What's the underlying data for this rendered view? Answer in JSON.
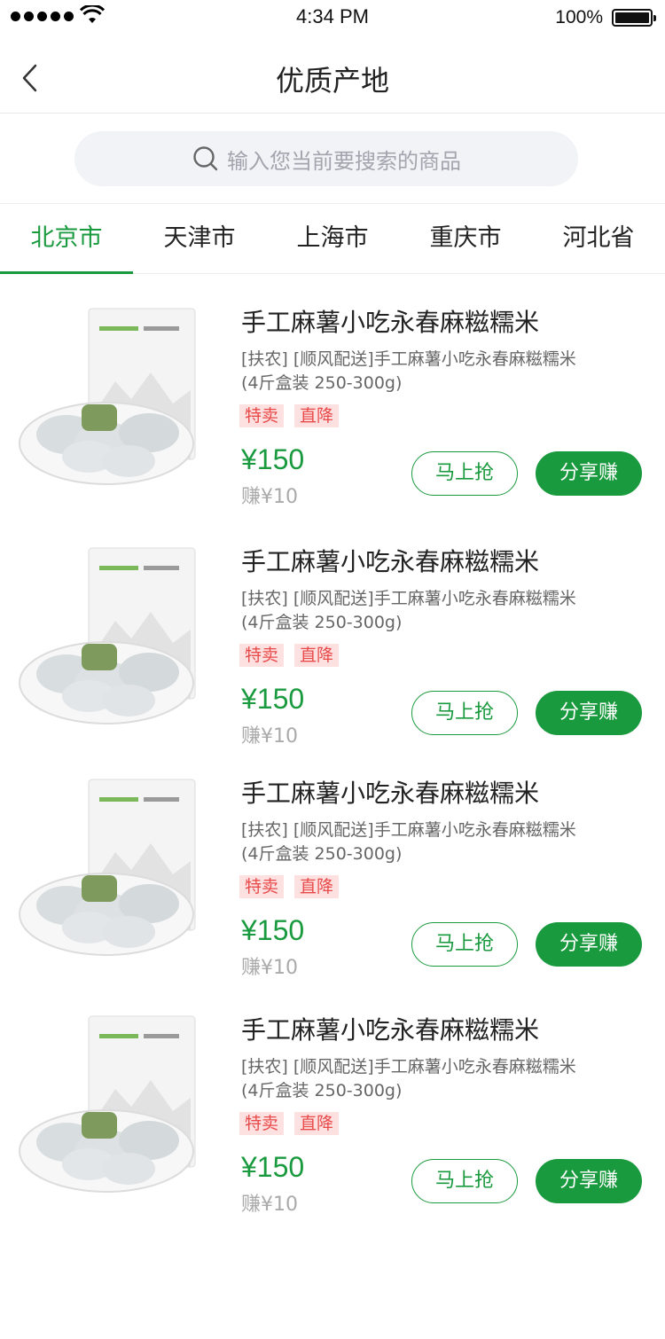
{
  "status_bar": {
    "time": "4:34 PM",
    "battery": "100%"
  },
  "nav": {
    "title": "优质产地"
  },
  "search": {
    "placeholder": "输入您当前要搜索的商品"
  },
  "tabs": [
    {
      "label": "北京市",
      "active": true
    },
    {
      "label": "天津市",
      "active": false
    },
    {
      "label": "上海市",
      "active": false
    },
    {
      "label": "重庆市",
      "active": false
    },
    {
      "label": "河北省",
      "active": false
    }
  ],
  "colors": {
    "accent": "#1a9a3e",
    "tag_text": "#e84a4a",
    "tag_bg": "#fde0e0"
  },
  "products": [
    {
      "title": "手工麻薯小吃永春麻糍糯米",
      "desc_line1": "[扶农] [顺风配送]手工麻薯小吃永春麻糍糯米",
      "desc_line2": "(4斤盒装 250-300g)",
      "tag1": "特卖",
      "tag2": "直降",
      "price": "¥150",
      "earn": "赚¥10",
      "grab_label": "马上抢",
      "share_label": "分享赚"
    },
    {
      "title": "手工麻薯小吃永春麻糍糯米",
      "desc_line1": "[扶农] [顺风配送]手工麻薯小吃永春麻糍糯米",
      "desc_line2": "(4斤盒装 250-300g)",
      "tag1": "特卖",
      "tag2": "直降",
      "price": "¥150",
      "earn": "赚¥10",
      "grab_label": "马上抢",
      "share_label": "分享赚"
    },
    {
      "title": "手工麻薯小吃永春麻糍糯米",
      "desc_line1": "[扶农] [顺风配送]手工麻薯小吃永春麻糍糯米",
      "desc_line2": "(4斤盒装 250-300g)",
      "tag1": "特卖",
      "tag2": "直降",
      "price": "¥150",
      "earn": "赚¥10",
      "grab_label": "马上抢",
      "share_label": "分享赚"
    },
    {
      "title": "手工麻薯小吃永春麻糍糯米",
      "desc_line1": "[扶农] [顺风配送]手工麻薯小吃永春麻糍糯米",
      "desc_line2": "(4斤盒装 250-300g)",
      "tag1": "特卖",
      "tag2": "直降",
      "price": "¥150",
      "earn": "赚¥10",
      "grab_label": "马上抢",
      "share_label": "分享赚"
    }
  ]
}
